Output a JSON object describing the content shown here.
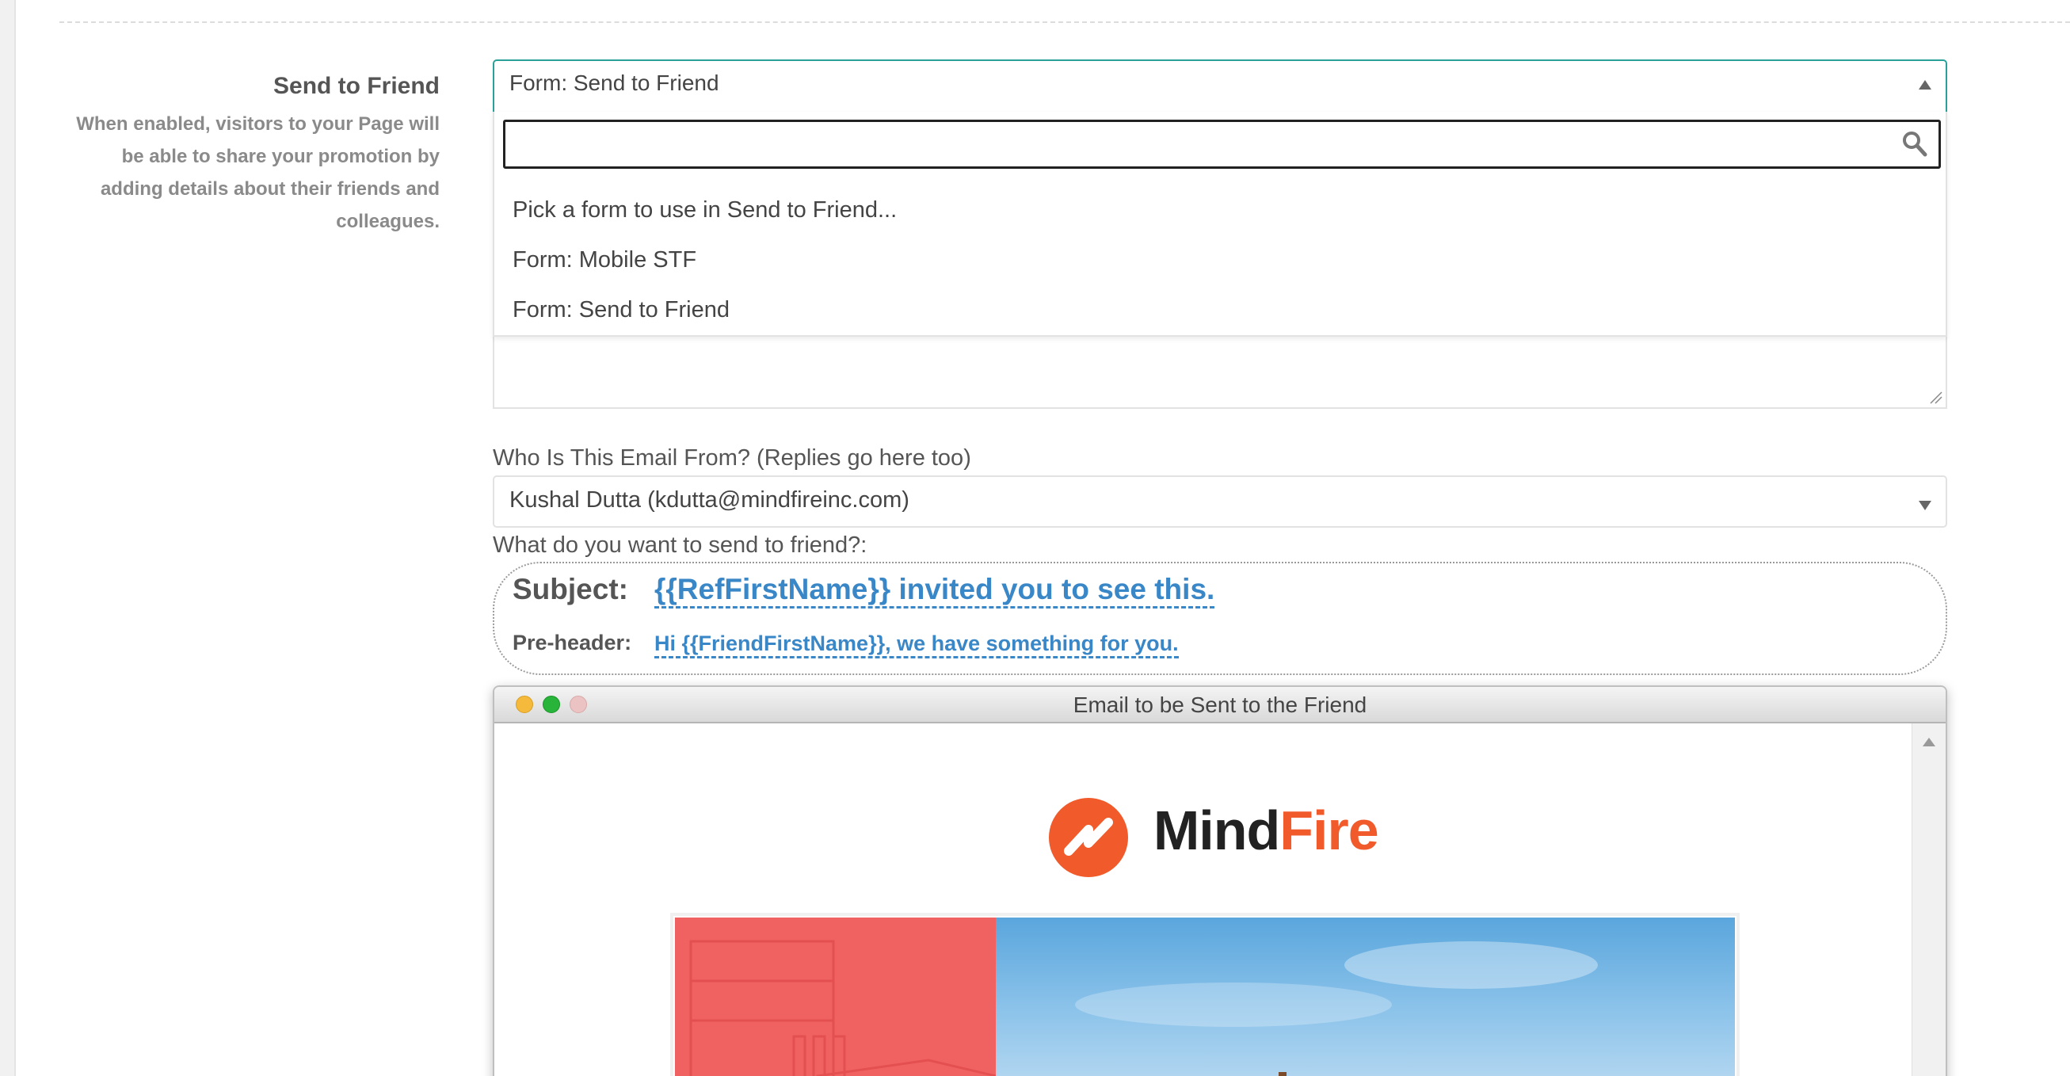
{
  "section": {
    "title": "Send to Friend",
    "description": "When enabled, visitors to your Page will be able to share your promotion by adding details about their friends and colleagues."
  },
  "form_select": {
    "selected": "Form: Send to Friend",
    "search_value": "",
    "options": [
      "Pick a form to use in Send to Friend...",
      "Form: Mobile STF",
      "Form: Send to Friend"
    ]
  },
  "from_field": {
    "label": "Who Is This Email From? (Replies go here too)",
    "selected": "Kushal Dutta (kdutta@mindfireinc.com)"
  },
  "send_field": {
    "label": "What do you want to send to friend?:"
  },
  "email": {
    "subject_label": "Subject:",
    "subject": "{{RefFirstName}} invited you to see this.",
    "preheader_label": "Pre-header:",
    "preheader": "Hi {{FriendFirstName}}, we have something for you."
  },
  "preview": {
    "window_title": "Email to be Sent to the Friend",
    "logo_text_1": "Mind",
    "logo_text_2": "Fire"
  },
  "colors": {
    "accent_teal": "#2aa198",
    "link_blue": "#3a87c8",
    "brand_orange": "#f15a2b",
    "hero_red": "#f06262"
  }
}
